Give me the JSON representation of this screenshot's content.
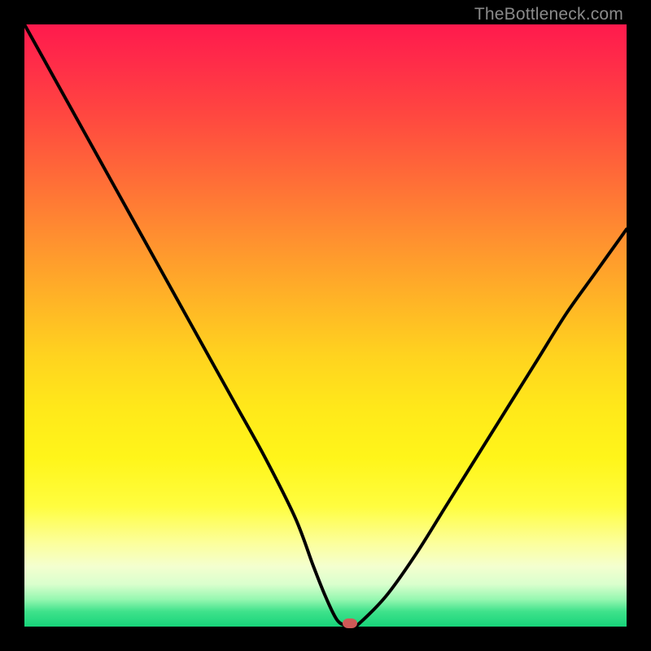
{
  "watermark": "TheBottleneck.com",
  "colors": {
    "frame": "#000000",
    "curve": "#000000",
    "marker": "#cf5a57"
  },
  "chart_data": {
    "type": "line",
    "title": "",
    "xlabel": "",
    "ylabel": "",
    "xlim": [
      0,
      100
    ],
    "ylim": [
      0,
      100
    ],
    "grid": false,
    "legend": false,
    "annotations": [],
    "series": [
      {
        "name": "bottleneck-curve",
        "x": [
          0,
          5,
          10,
          15,
          20,
          25,
          30,
          35,
          40,
          45,
          48,
          50,
          52,
          54,
          55,
          60,
          65,
          70,
          75,
          80,
          85,
          90,
          95,
          100
        ],
        "values": [
          100,
          91,
          82,
          73,
          64,
          55,
          46,
          37,
          28,
          18,
          10,
          5,
          1,
          0,
          0,
          5,
          12,
          20,
          28,
          36,
          44,
          52,
          59,
          66
        ]
      }
    ],
    "marker": {
      "x": 54,
      "y": 0
    },
    "background_gradient": {
      "direction": "top-to-bottom",
      "stops": [
        {
          "pct": 0,
          "color": "#ff1a4d"
        },
        {
          "pct": 25,
          "color": "#ff6a38"
        },
        {
          "pct": 55,
          "color": "#ffd31f"
        },
        {
          "pct": 80,
          "color": "#fffd3f"
        },
        {
          "pct": 93,
          "color": "#d9ffcd"
        },
        {
          "pct": 100,
          "color": "#17d47a"
        }
      ]
    }
  }
}
